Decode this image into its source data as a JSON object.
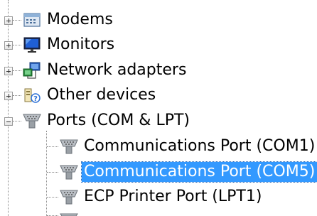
{
  "tree": {
    "categories": [
      {
        "label": "Modems",
        "icon": "modem-icon",
        "expanded": false
      },
      {
        "label": "Monitors",
        "icon": "monitor-icon",
        "expanded": false
      },
      {
        "label": "Network adapters",
        "icon": "network-adapter-icon",
        "expanded": false
      },
      {
        "label": "Other devices",
        "icon": "unknown-device-icon",
        "expanded": false
      },
      {
        "label": "Ports (COM & LPT)",
        "icon": "port-icon",
        "expanded": true
      }
    ],
    "ports": [
      {
        "label": "Communications Port (COM1)",
        "icon": "port-icon",
        "selected": false
      },
      {
        "label": "Communications Port (COM5)",
        "icon": "port-icon",
        "selected": true
      },
      {
        "label": "ECP Printer Port (LPT1)",
        "icon": "port-icon",
        "selected": false
      }
    ]
  },
  "colors": {
    "selection_bg": "#3399ff",
    "selection_text": "#ffffff",
    "tree_lines": "#8a8a8a"
  }
}
